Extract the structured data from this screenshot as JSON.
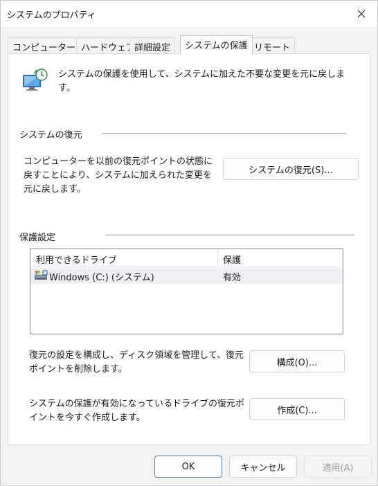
{
  "window": {
    "title": "システムのプロパティ"
  },
  "tabs": [
    {
      "label": "コンピューター名"
    },
    {
      "label": "ハードウェア"
    },
    {
      "label": "詳細設定"
    },
    {
      "label": "システムの保護",
      "active": true
    },
    {
      "label": "リモート"
    }
  ],
  "intro": {
    "text": "システムの保護を使用して、システムに加えた不要な変更を元に戻します。"
  },
  "restore": {
    "group_title": "システムの復元",
    "description": "コンピューターを以前の復元ポイントの状態に戻すことにより、システムに加えられた変更を元に戻します。",
    "button_label": "システムの復元(S)..."
  },
  "protection": {
    "group_title": "保護設定",
    "columns": [
      "利用できるドライブ",
      "保護"
    ],
    "rows": [
      {
        "drive": "Windows (C:) (システム)",
        "status": "有効"
      }
    ],
    "configure_desc": "復元の設定を構成し、ディスク領域を管理して、復元ポイントを削除します。",
    "configure_button": "構成(O)...",
    "create_desc": "システムの保護が有効になっているドライブの復元ポイントを今すぐ作成します。",
    "create_button": "作成(C)..."
  },
  "footer": {
    "ok": "OK",
    "cancel": "キャンセル",
    "apply": "適用(A)"
  },
  "icons": {
    "close": "close-icon",
    "system_protection": "system-protection-icon",
    "drive": "drive-icon"
  },
  "colors": {
    "primary_border": "#5a7fa8",
    "row_highlight": "#eef0f3"
  }
}
